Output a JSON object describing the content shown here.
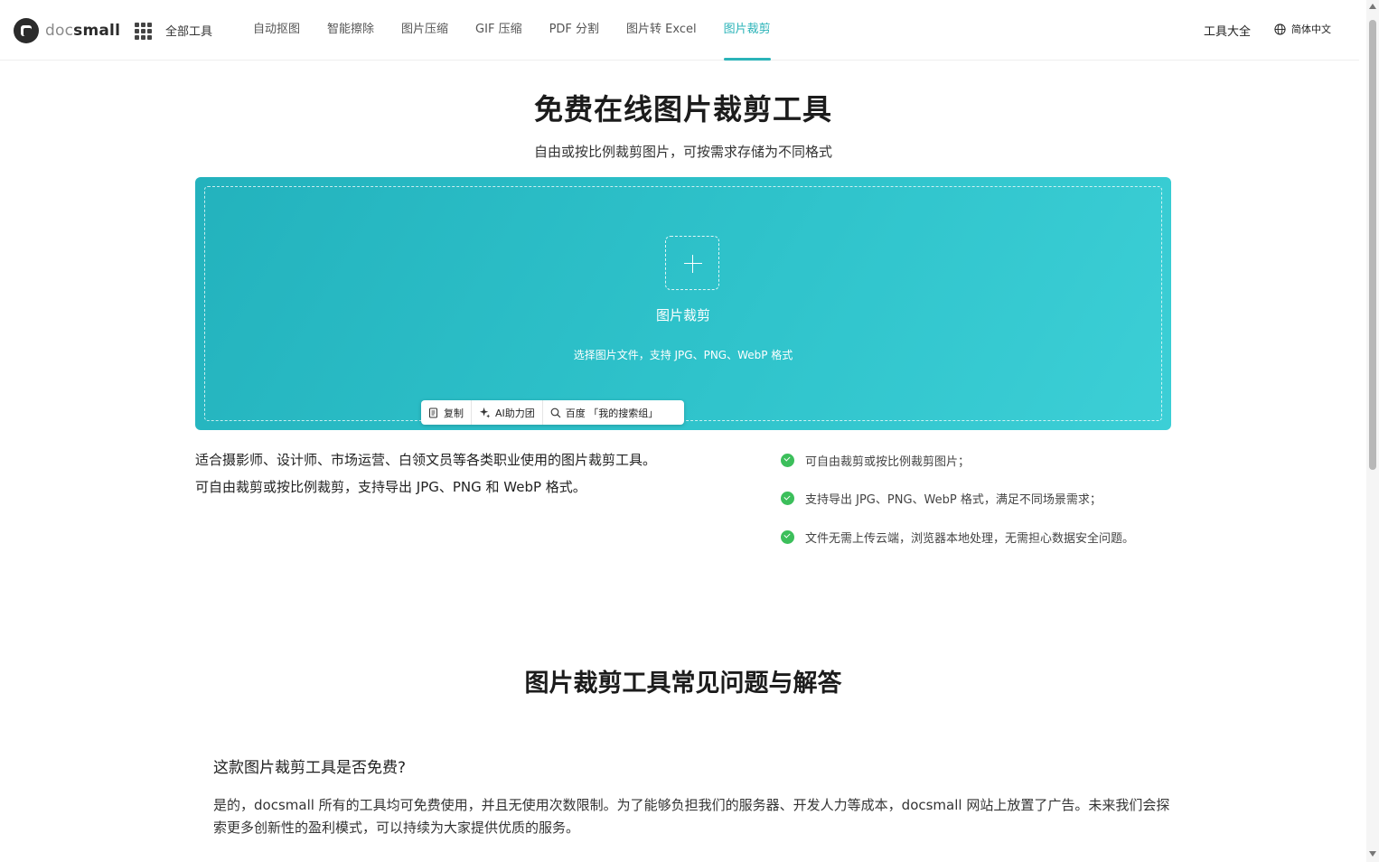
{
  "header": {
    "logo_light": "doc",
    "logo_dark": "small",
    "all_tools": "全部工具",
    "nav": [
      {
        "label": "自动抠图",
        "active": false
      },
      {
        "label": "智能擦除",
        "active": false
      },
      {
        "label": "图片压缩",
        "active": false
      },
      {
        "label": "GIF 压缩",
        "active": false
      },
      {
        "label": "PDF 分割",
        "active": false
      },
      {
        "label": "图片转 Excel",
        "active": false
      },
      {
        "label": "图片裁剪",
        "active": true
      }
    ],
    "tools_all": "工具大全",
    "language": "简体中文"
  },
  "hero": {
    "title": "免费在线图片裁剪工具",
    "subtitle": "自由或按比例裁剪图片，可按需求存储为不同格式",
    "drop_label": "图片裁剪",
    "drop_hint": "选择图片文件，支持 JPG、PNG、WebP 格式"
  },
  "mini_toolbar": {
    "copy": "复制",
    "ai": "AI助力团",
    "search": "百度 「我的搜索组」"
  },
  "info": {
    "description": "适合摄影师、设计师、市场运营、白领文员等各类职业使用的图片裁剪工具。可自由裁剪或按比例裁剪，支持导出 JPG、PNG 和 WebP 格式。",
    "features": [
      "可自由裁剪或按比例裁剪图片；",
      "支持导出 JPG、PNG、WebP 格式，满足不同场景需求；",
      "文件无需上传云端，浏览器本地处理，无需担心数据安全问题。"
    ]
  },
  "faq": {
    "title": "图片裁剪工具常见问题与解答",
    "items": [
      {
        "question": "这款图片裁剪工具是否免费?",
        "answer": "是的，docsmall 所有的工具均可免费使用，并且无使用次数限制。为了能够负担我们的服务器、开发人力等成本，docsmall 网站上放置了广告。未来我们会探索更多创新性的盈利模式，可以持续为大家提供优质的服务。"
      }
    ]
  },
  "colors": {
    "accent": "#2ab3b8",
    "check": "#3cbf5b",
    "dropzone_start": "#23b2bd",
    "dropzone_end": "#3ccfd6"
  }
}
